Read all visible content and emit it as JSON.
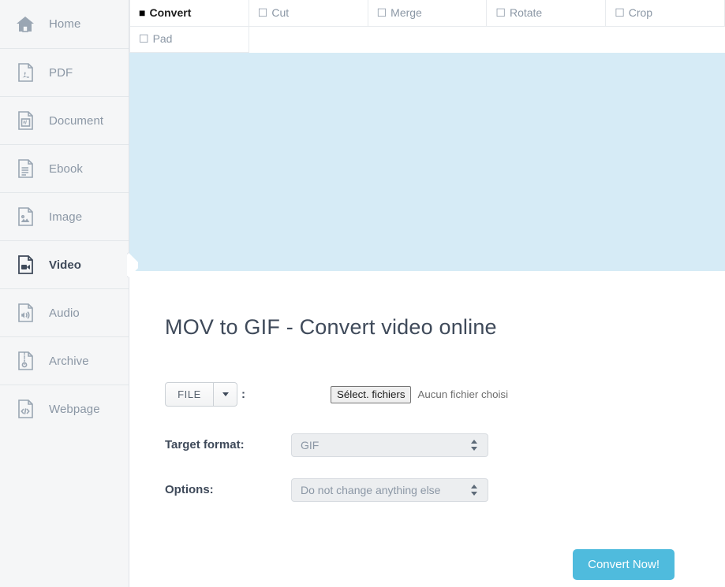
{
  "sidebar": {
    "items": [
      {
        "label": "Home",
        "icon": "home-icon",
        "active": false
      },
      {
        "label": "PDF",
        "icon": "pdf-file-icon",
        "active": false
      },
      {
        "label": "Document",
        "icon": "word-document-icon",
        "active": false
      },
      {
        "label": "Ebook",
        "icon": "ebook-file-icon",
        "active": false
      },
      {
        "label": "Image",
        "icon": "image-file-icon",
        "active": false
      },
      {
        "label": "Video",
        "icon": "video-file-icon",
        "active": true
      },
      {
        "label": "Audio",
        "icon": "audio-file-icon",
        "active": false
      },
      {
        "label": "Archive",
        "icon": "archive-file-icon",
        "active": false
      },
      {
        "label": "Webpage",
        "icon": "code-file-icon",
        "active": false
      }
    ]
  },
  "tabs": {
    "checked_glyph": "■",
    "unchecked_glyph": "☐",
    "row1": [
      {
        "label": "Convert",
        "selected": true
      },
      {
        "label": "Cut",
        "selected": false
      },
      {
        "label": "Merge",
        "selected": false
      },
      {
        "label": "Rotate",
        "selected": false
      },
      {
        "label": "Crop",
        "selected": false
      }
    ],
    "row2": [
      {
        "label": "Pad",
        "selected": false
      }
    ]
  },
  "main": {
    "title": "MOV to GIF - Convert video online",
    "file_row": {
      "source_button": "FILE",
      "dropdown_icon": "caret-down-icon",
      "colon": ":",
      "choose_button": "Sélect. fichiers",
      "status": "Aucun fichier choisi"
    },
    "target_format": {
      "label": "Target format:",
      "value": "GIF"
    },
    "options": {
      "label": "Options:",
      "value": "Do not change anything else"
    },
    "convert_button": "Convert Now!"
  },
  "colors": {
    "banner": "#d6ebf6",
    "accent": "#4fbbdd",
    "sidebar_bg": "#f5f6f7",
    "text_muted": "#8b97a5",
    "text_dark": "#3f4a5a"
  }
}
